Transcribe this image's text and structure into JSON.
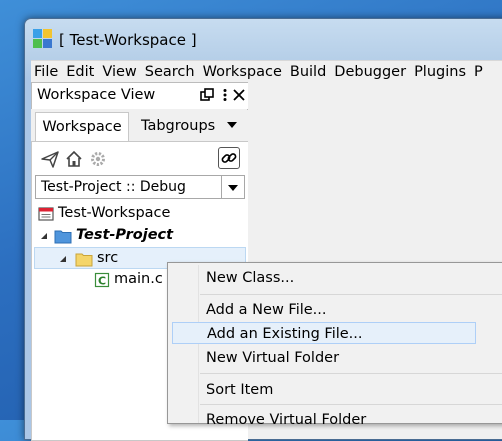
{
  "window": {
    "title": "[ Test-Workspace ]"
  },
  "menubar": {
    "items": [
      "File",
      "Edit",
      "View",
      "Search",
      "Workspace",
      "Build",
      "Debugger",
      "Plugins",
      "P"
    ]
  },
  "workspace_view": {
    "title": "Workspace View",
    "tabs": [
      {
        "label": "Workspace",
        "active": true
      },
      {
        "label": "Tabgroups",
        "active": false
      }
    ],
    "toolbar": {
      "icons": [
        "send-icon",
        "home-icon",
        "gear-icon",
        "link-icon"
      ]
    },
    "config_combo": {
      "value": "Test-Project :: Debug"
    },
    "tree": [
      {
        "label": "Test-Workspace",
        "icon": "workspace-icon"
      },
      {
        "label": "Test-Project",
        "icon": "project-folder-icon",
        "bold": true
      },
      {
        "label": "src",
        "icon": "folder-icon",
        "selected": true
      },
      {
        "label": "main.c",
        "icon": "c-file-icon"
      }
    ]
  },
  "context_menu": {
    "items": [
      "New Class...",
      "Add a New File...",
      "Add an Existing File...",
      "New Virtual Folder",
      "Sort Item",
      "Remove Virtual Folder"
    ],
    "highlighted": "Add an Existing File..."
  }
}
